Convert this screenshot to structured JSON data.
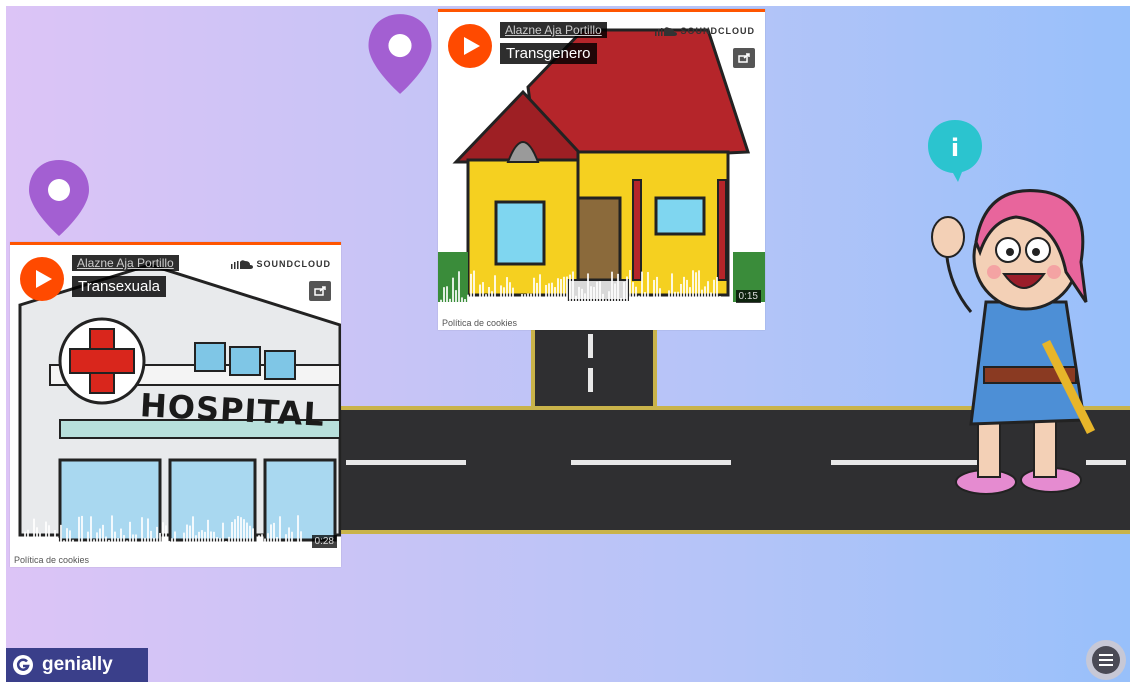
{
  "embeds": [
    {
      "artist": "Alazne Aja Portillo",
      "track": "Transexuala",
      "brand": "SOUNDCLOUD",
      "duration": "0:28",
      "cookies": "Política de cookies",
      "art_label": "HOSPITAL"
    },
    {
      "artist": "Alazne Aja Portillo",
      "track": "Transgenero",
      "brand": "SOUNDCLOUD",
      "duration": "0:15",
      "cookies": "Política de cookies"
    }
  ],
  "info_icon": {
    "glyph": "i",
    "color": "#2bc4cf"
  },
  "pin_color": "#a35fd2",
  "branding": {
    "name": "genially"
  },
  "accent_color": "#ff5500"
}
